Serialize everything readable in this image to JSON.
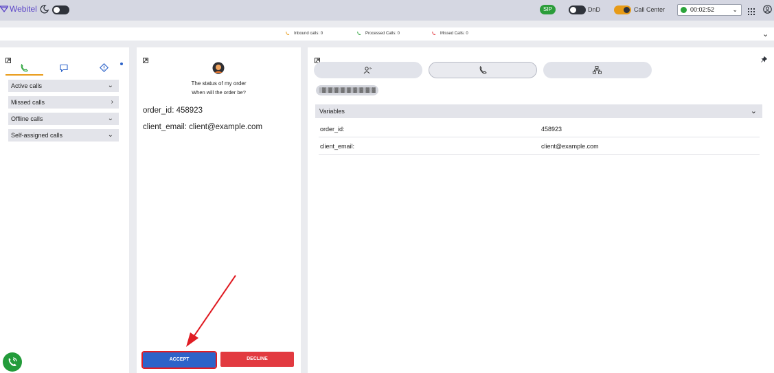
{
  "header": {
    "logo_text": "Webitel",
    "sip_label": "SIP",
    "dnd_label": "DnD",
    "callcenter_label": "Call Center",
    "timer_value": "00:02:52"
  },
  "stats": {
    "inbound": "Inbound calls: 0",
    "processed": "Processed Calls: 0",
    "missed": "Missed Calls: 0"
  },
  "sidebar": {
    "tabs": [
      {
        "icon": "phone-icon"
      },
      {
        "icon": "chat-icon"
      },
      {
        "icon": "alert-icon"
      }
    ],
    "items": [
      {
        "label": "Active calls",
        "chevron": "down"
      },
      {
        "label": "Missed calls",
        "chevron": "right"
      },
      {
        "label": "Offline calls",
        "chevron": "down"
      },
      {
        "label": "Self-assigned calls",
        "chevron": "down"
      }
    ]
  },
  "call": {
    "title": "The status of my order",
    "subtitle": "When will the order be?",
    "vars": [
      {
        "key": "order_id:",
        "value": "458923"
      },
      {
        "key": "client_email:",
        "value": "client@example.com"
      }
    ],
    "accept_label": "ACCEPT",
    "decline_label": "DECLINE"
  },
  "details": {
    "blurred_tag": "▒▓▒▓▒▓▒▓▒▓▒▓▒▓▒▓▒▓",
    "variables_header": "Variables",
    "rows": [
      {
        "key": "order_id:",
        "value": "458923"
      },
      {
        "key": "client_email:",
        "value": "client@example.com"
      }
    ]
  },
  "colors": {
    "accent": "#e99b18",
    "accept": "#2d63c9",
    "decline": "#e23a40",
    "annotation": "#e01d24",
    "online": "#2ba43b"
  }
}
